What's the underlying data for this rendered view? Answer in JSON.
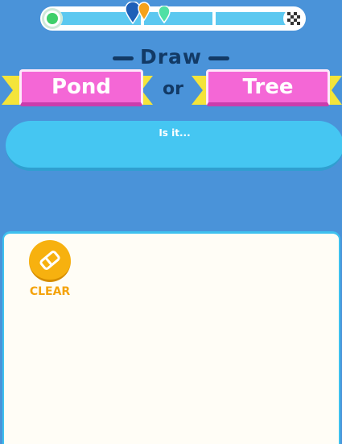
{
  "progress": {
    "start_icon": "start-circle-icon",
    "finish_icon": "checkered-flag-icon",
    "markers": [
      "blue-pin-icon",
      "orange-pin-icon",
      "green-pin-icon"
    ],
    "colors": {
      "track": "#5cc8f0",
      "start": "#3fcf6a"
    }
  },
  "prompt": {
    "title": "Draw",
    "option_a": "Pond",
    "or_text": "or",
    "option_b": "Tree"
  },
  "guess": {
    "text": "Is it..."
  },
  "canvas": {
    "clear_label": "CLEAR",
    "clear_icon": "eraser-icon"
  },
  "colors": {
    "background": "#4a93d9",
    "banner": "#f467d6",
    "ribbon": "#f4e43a",
    "guess_bar": "#45c6f2",
    "clear": "#f7b10f",
    "title": "#123a66"
  }
}
